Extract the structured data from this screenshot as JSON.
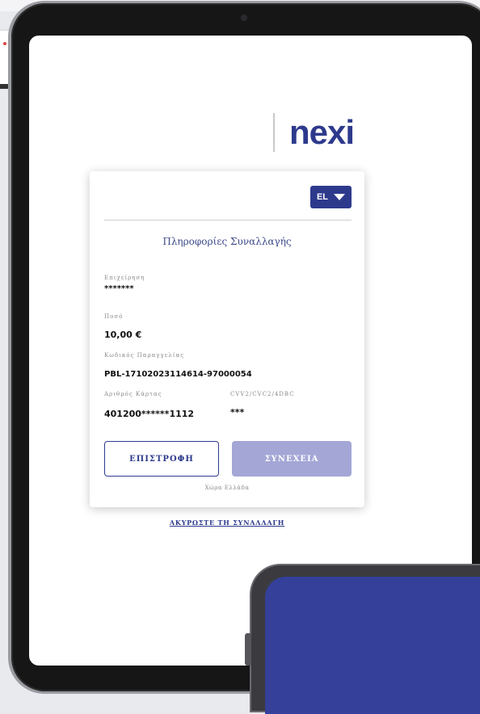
{
  "brand": {
    "logo": "nexi"
  },
  "language_selector": {
    "value": "EL"
  },
  "card": {
    "title": "Πληροφορίες Συναλλαγής",
    "fields": {
      "business_label": "Επιχείρηση",
      "business_value": "*******",
      "amount_label": "Ποσό",
      "amount_value": "10,00 €",
      "order_code_label": "Κωδικός Παραγγελίας",
      "order_code_value": "PBL-17102023114614-97000054",
      "card_number_label": "Αριθμός Κάρτας",
      "card_number_value": "401200******1112",
      "cvv_label": "CVV2/CVC2/4DBC",
      "cvv_value": "***"
    },
    "buttons": {
      "back": "ΕΠΙΣΤΡΟΦΗ",
      "next": "ΣΥΝΕΧΕΙΑ"
    },
    "country": "Χώρα Ελλάδα"
  },
  "cancel_link": "ΑΚΥΡΩΣΤΕ ΤΗ ΣΥΝΑΛΛΑΓΗ",
  "colors": {
    "brand": "#2d3a8c",
    "next_button": "#a4a6d6",
    "phone_screen": "#34409a"
  }
}
